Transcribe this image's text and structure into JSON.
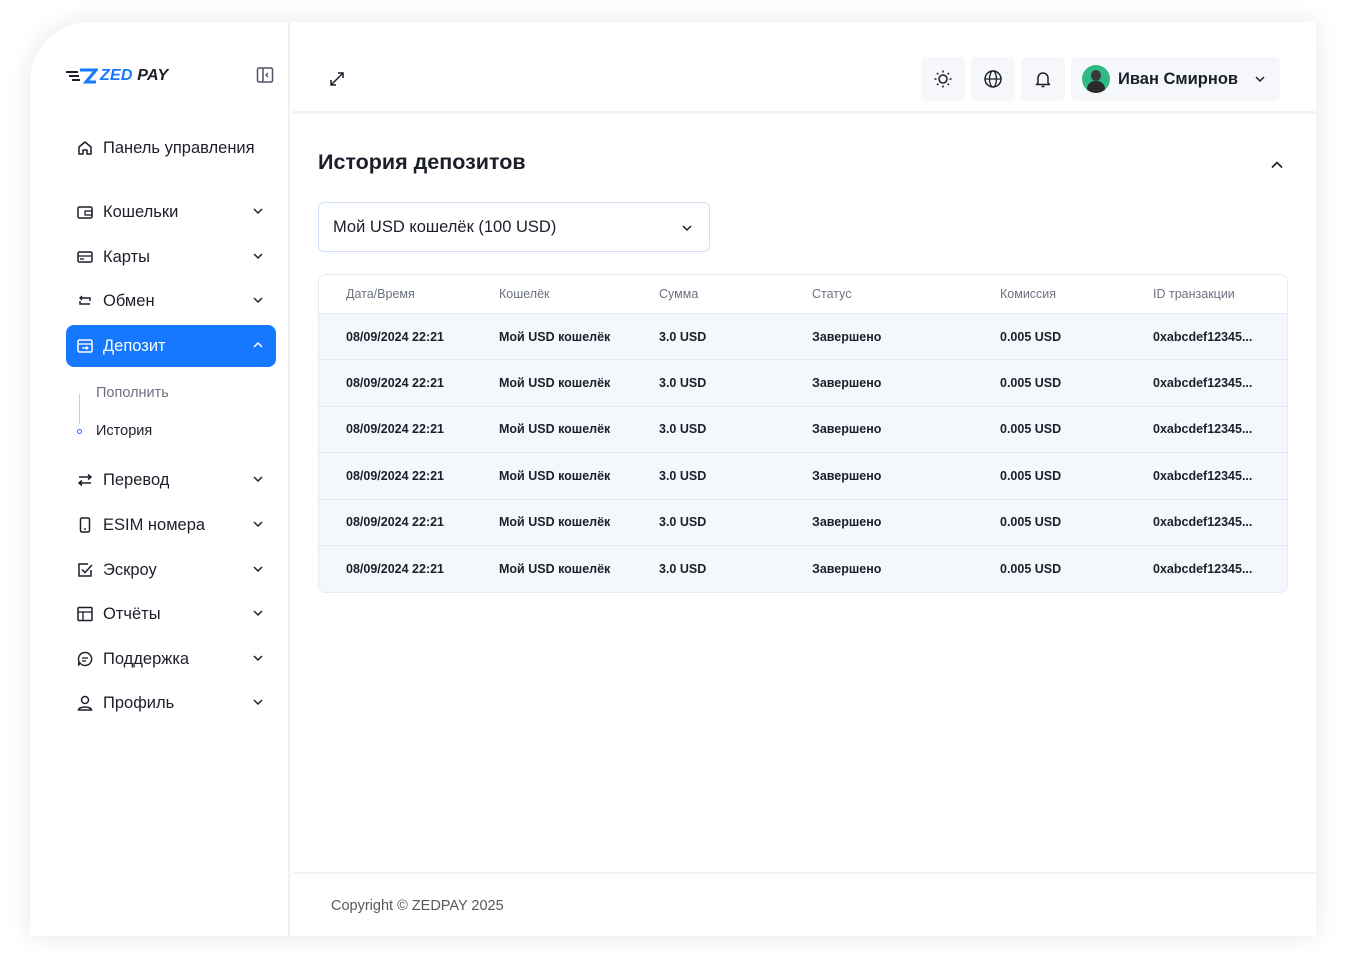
{
  "brand": {
    "logo_part1": "ZED",
    "logo_part2": "PAY"
  },
  "sidebar": {
    "items": [
      {
        "label": "Панель управления",
        "icon": "home-icon"
      },
      {
        "label": "Кошельки",
        "icon": "wallet-icon"
      },
      {
        "label": "Карты",
        "icon": "card-icon"
      },
      {
        "label": "Обмен",
        "icon": "exchange-icon"
      },
      {
        "label": "Депозит",
        "icon": "deposit-icon",
        "active": true
      },
      {
        "label": "Перевод",
        "icon": "transfer-icon"
      },
      {
        "label": "ESIM номера",
        "icon": "sim-icon"
      },
      {
        "label": "Эскроу",
        "icon": "escrow-check-icon"
      },
      {
        "label": "Отчёты",
        "icon": "report-table-icon"
      },
      {
        "label": "Поддержка",
        "icon": "chat-icon"
      },
      {
        "label": "Профиль",
        "icon": "user-icon"
      }
    ],
    "deposit_sub": [
      {
        "label": "Пополнить"
      },
      {
        "label": "История",
        "active": true
      }
    ]
  },
  "header": {
    "icons": [
      "sun-icon",
      "globe-icon",
      "bell-icon"
    ],
    "user_name": "Иван Смирнов"
  },
  "main": {
    "title": "История депозитов",
    "wallet_select": "Мой USD кошелёк (100 USD)",
    "table": {
      "columns": [
        "Дата/Время",
        "Кошелёк",
        "Сумма",
        "Статус",
        "Комиссия",
        "ID транзакции"
      ],
      "rows": [
        [
          "08/09/2024 22:21",
          "Мой USD кошелёк",
          "3.0 USD",
          "Завершено",
          "0.005 USD",
          "0xabcdef12345..."
        ],
        [
          "08/09/2024 22:21",
          "Мой USD кошелёк",
          "3.0 USD",
          "Завершено",
          "0.005 USD",
          "0xabcdef12345..."
        ],
        [
          "08/09/2024 22:21",
          "Мой USD кошелёк",
          "3.0 USD",
          "Завершено",
          "0.005 USD",
          "0xabcdef12345..."
        ],
        [
          "08/09/2024 22:21",
          "Мой USD кошелёк",
          "3.0 USD",
          "Завершено",
          "0.005 USD",
          "0xabcdef12345..."
        ],
        [
          "08/09/2024 22:21",
          "Мой USD кошелёк",
          "3.0 USD",
          "Завершено",
          "0.005 USD",
          "0xabcdef12345..."
        ],
        [
          "08/09/2024 22:21",
          "Мой USD кошелёк",
          "3.0 USD",
          "Завершено",
          "0.005 USD",
          "0xabcdef12345..."
        ]
      ]
    }
  },
  "footer": {
    "copyright": "Copyright © ZEDPAY 2025"
  },
  "colors": {
    "accent": "#1677ff",
    "row_bg": "#f4f8fd",
    "border": "#e3ecf8"
  }
}
